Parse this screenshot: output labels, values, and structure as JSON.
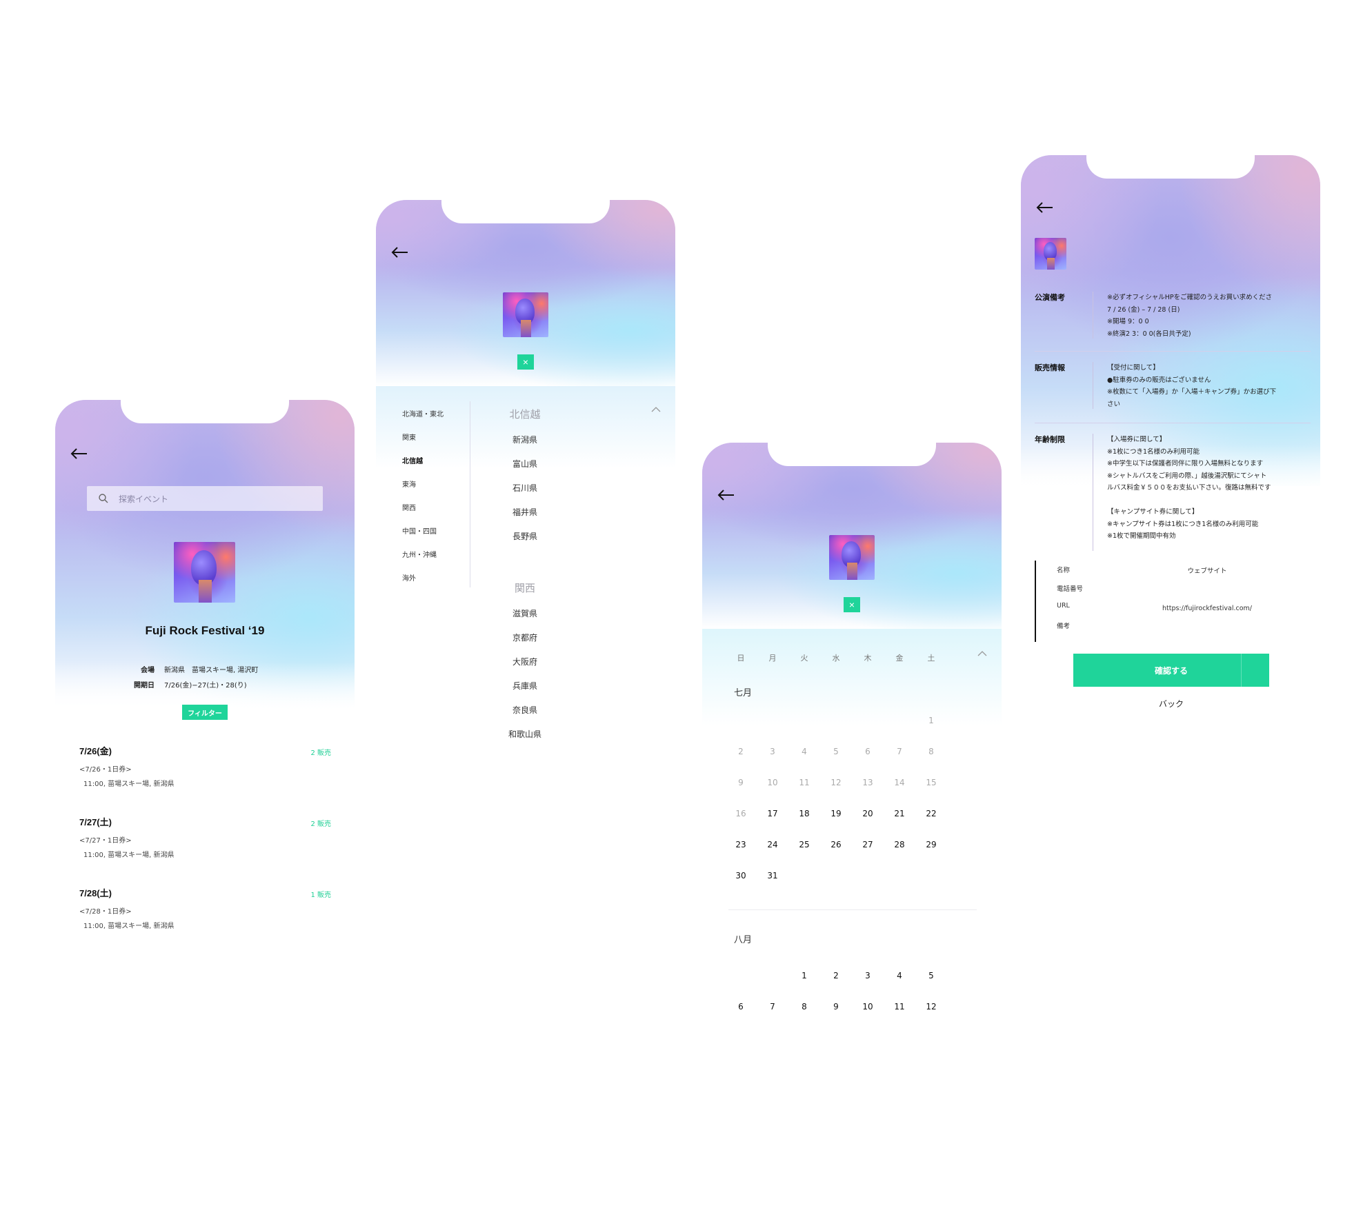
{
  "screen1": {
    "search_placeholder": "探索イベント",
    "title": "Fuji Rock Festival ‘19",
    "venue_label": "会場",
    "venue_value": "新潟県　苗場スキー場, 湯沢町",
    "date_label": "開期日",
    "date_value": "7/26(金)−27(土)・28(り)",
    "filter_label": "フィルター",
    "events": [
      {
        "date": "7/26(金)",
        "sale": "2 販売",
        "ticket": "<7/26・1日券>",
        "venue": "11:00,  苗場スキー場,  新潟県"
      },
      {
        "date": "7/27(土)",
        "sale": "2 販売",
        "ticket": "<7/27・1日券>",
        "venue": "11:00,  苗場スキー場,  新潟県"
      },
      {
        "date": "7/28(土)",
        "sale": "1 販売",
        "ticket": "<7/28・1日券>",
        "venue": "11:00,  苗場スキー場,  新潟県"
      }
    ]
  },
  "screen2": {
    "close_label": "×",
    "regions": [
      "北海道・東北",
      "関東",
      "北信越",
      "東海",
      "関西",
      "中国・四国",
      "九州・沖縄",
      "海外"
    ],
    "active_region": "北信越",
    "group1": {
      "heading": "北信越",
      "prefectures": [
        "新潟県",
        "富山県",
        "石川県",
        "福井県",
        "長野県"
      ]
    },
    "group2": {
      "heading": "関西",
      "prefectures": [
        "滋賀県",
        "京都府",
        "大阪府",
        "兵庫県",
        "奈良県",
        "和歌山県"
      ]
    }
  },
  "screen3": {
    "close_label": "×",
    "weekdays": [
      "日",
      "月",
      "火",
      "水",
      "木",
      "金",
      "土"
    ],
    "month1": "七月",
    "month2": "八月",
    "july_rows": [
      [
        "",
        "",
        "",
        "",
        "",
        "",
        "1"
      ],
      [
        "2",
        "3",
        "4",
        "5",
        "6",
        "7",
        "8"
      ],
      [
        "9",
        "10",
        "11",
        "12",
        "13",
        "14",
        "15"
      ],
      [
        "16",
        "17",
        "18",
        "19",
        "20",
        "21",
        "22"
      ],
      [
        "23",
        "24",
        "25",
        "26",
        "27",
        "28",
        "29"
      ],
      [
        "30",
        "31",
        "",
        "",
        "",
        "",
        ""
      ]
    ],
    "july_first_active": 17,
    "august_rows": [
      [
        "",
        "",
        "1",
        "2",
        "3",
        "4",
        "5"
      ],
      [
        "6",
        "7",
        "8",
        "9",
        "10",
        "11",
        "12"
      ]
    ]
  },
  "screen4": {
    "sections": [
      {
        "heading": "公演備考",
        "body": "※必ずオフィシャルHPをご確認のうえお買い求めくださ\n7 / 26 (金) – 7 / 28 (日)\n※開場 9：0 0\n※終演2 3：0 0(各日共予定)"
      },
      {
        "heading": "販売情報",
        "body": "【受付に関して】\n●駐車券のみの販売はございません\n※枚数にて「入場券」か「入場＋キャンプ券」かお選び下\nさい"
      },
      {
        "heading": "年齢制限",
        "body": "【入場券に関して】\n※1枚につき1名様のみ利用可能\n※中学生以下は保護者同伴に限り入場無料となります\n※シャトルバスをご利用の際、」越後湯沢駅にてシャト\nルバス料金￥５００をお支払い下さい。復路は無料です\n\n【キャンプサイト券に関して】\n※キャンプサイト券は1枚につき1名様のみ利用可能\n※1枚で開催期間中有効"
      }
    ],
    "contact": {
      "name_label": "名称",
      "name_value": "ウェブサイト",
      "phone_label": "電話番号",
      "phone_value": "",
      "url_label": "URL",
      "url_value": "https://fujirockfestival.com/",
      "note_label": "備考",
      "note_value": ""
    },
    "confirm_label": "確認する",
    "back_label": "バック"
  },
  "colors": {
    "accent": "#1fd49a",
    "gradient_purple": "#b8b4ee",
    "gradient_cyan": "#aae8fa",
    "gradient_pink": "#e2b6d6"
  }
}
